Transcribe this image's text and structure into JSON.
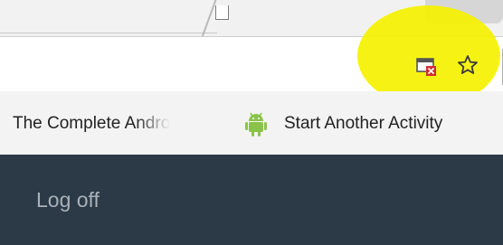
{
  "browser": {
    "toolbar": {
      "icons": [
        "popup-blocked-icon",
        "bookmark-star-icon"
      ],
      "highlight_color": "#f5f200"
    },
    "bookmarks": [
      {
        "label": "The Complete Andro",
        "icon": null
      },
      {
        "label": "Start Another Activity",
        "icon": "android-icon"
      }
    ]
  },
  "page": {
    "background": "#2c3a47",
    "logoff_label": "Log off"
  }
}
